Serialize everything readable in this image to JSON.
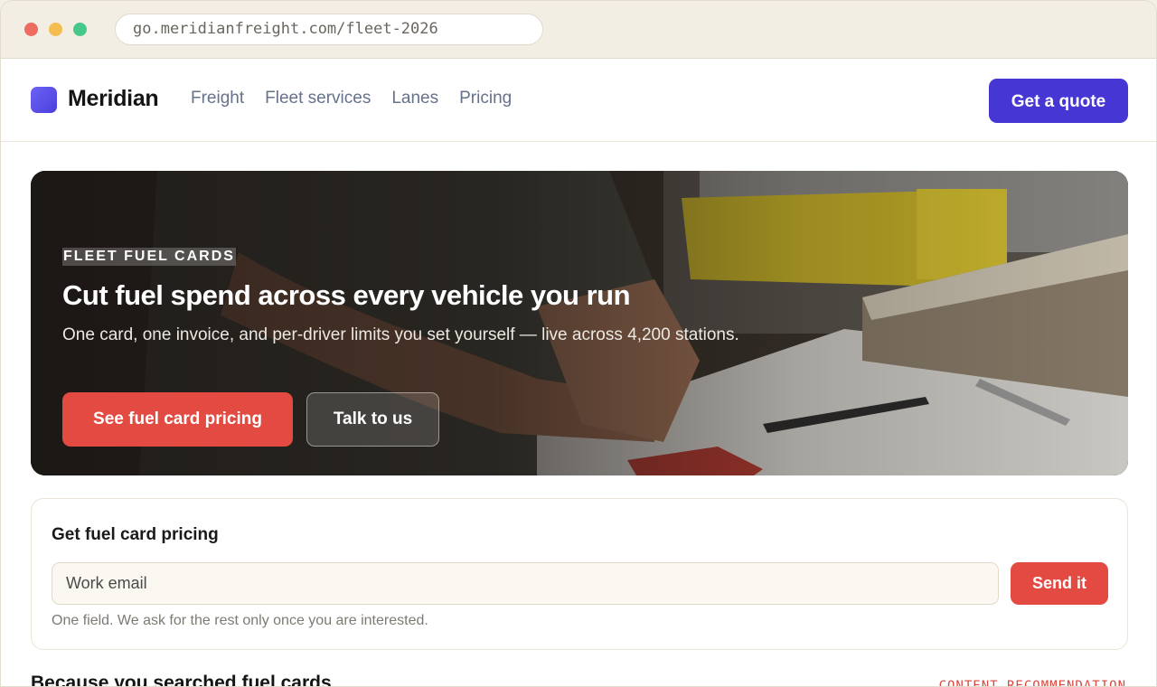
{
  "browser": {
    "url": "go.meridianfreight.com/fleet-2026"
  },
  "nav": {
    "brand": "Meridian",
    "links": [
      "Freight",
      "Fleet services",
      "Lanes",
      "Pricing"
    ],
    "cta_label": "Get a quote"
  },
  "hero": {
    "eyebrow": "FLEET FUEL CARDS",
    "title": "Cut fuel spend across every vehicle you run",
    "subtitle": "One card, one invoice, and per-driver limits you set yourself — live across 4,200 stations.",
    "primary_label": "See fuel card pricing",
    "secondary_label": "Talk to us"
  },
  "form": {
    "title": "Get fuel card pricing",
    "email_placeholder": "Work email",
    "submit_label": "Send it",
    "note": "One field. We ask for the rest only once you are interested."
  },
  "recommendations": {
    "title": "Because you searched fuel cards",
    "tag": "CONTENT RECOMMENDATION"
  },
  "colors": {
    "brand": "#4636d4",
    "accent": "#e24a42",
    "tag": "#d9493f"
  }
}
